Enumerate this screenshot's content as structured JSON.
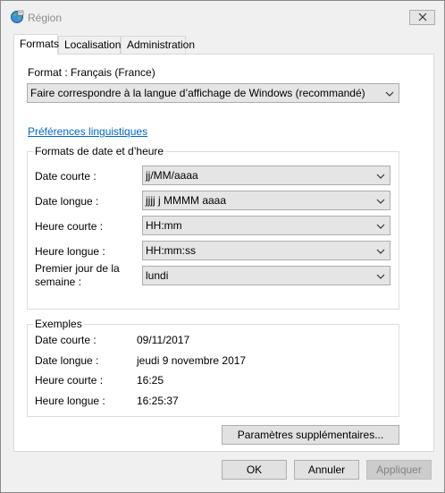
{
  "window": {
    "title": "Région"
  },
  "tabs": [
    {
      "label": "Formats"
    },
    {
      "label": "Localisation"
    },
    {
      "label": "Administration"
    }
  ],
  "format": {
    "label": "Format : Français (France)",
    "selected": "Faire correspondre à la langue d’affichage de Windows (recommandé)"
  },
  "language_prefs_link": "Préférences linguistiques",
  "date_time_group": {
    "title": "Formats de date et d’heure",
    "rows": [
      {
        "label": "Date courte :",
        "value": "jj/MM/aaaa"
      },
      {
        "label": "Date longue :",
        "value": "jjjj j MMMM aaaa"
      },
      {
        "label": "Heure courte :",
        "value": "HH:mm"
      },
      {
        "label": "Heure longue :",
        "value": "HH:mm:ss"
      },
      {
        "label_line1": "Premier jour de la",
        "label_line2": "semaine :",
        "value": "lundi"
      }
    ]
  },
  "examples": {
    "title": "Exemples",
    "rows": [
      {
        "label": "Date courte :",
        "value": "09/11/2017"
      },
      {
        "label": "Date longue :",
        "value": "jeudi 9 novembre 2017"
      },
      {
        "label": "Heure courte :",
        "value": "16:25"
      },
      {
        "label": "Heure longue :",
        "value": "16:25:37"
      }
    ]
  },
  "buttons": {
    "additional": "Paramètres supplémentaires...",
    "ok": "OK",
    "cancel": "Annuler",
    "apply": "Appliquer"
  },
  "icons": {
    "app": "globe-icon",
    "close": "close-icon",
    "dropdown": "chevron-down-icon"
  }
}
